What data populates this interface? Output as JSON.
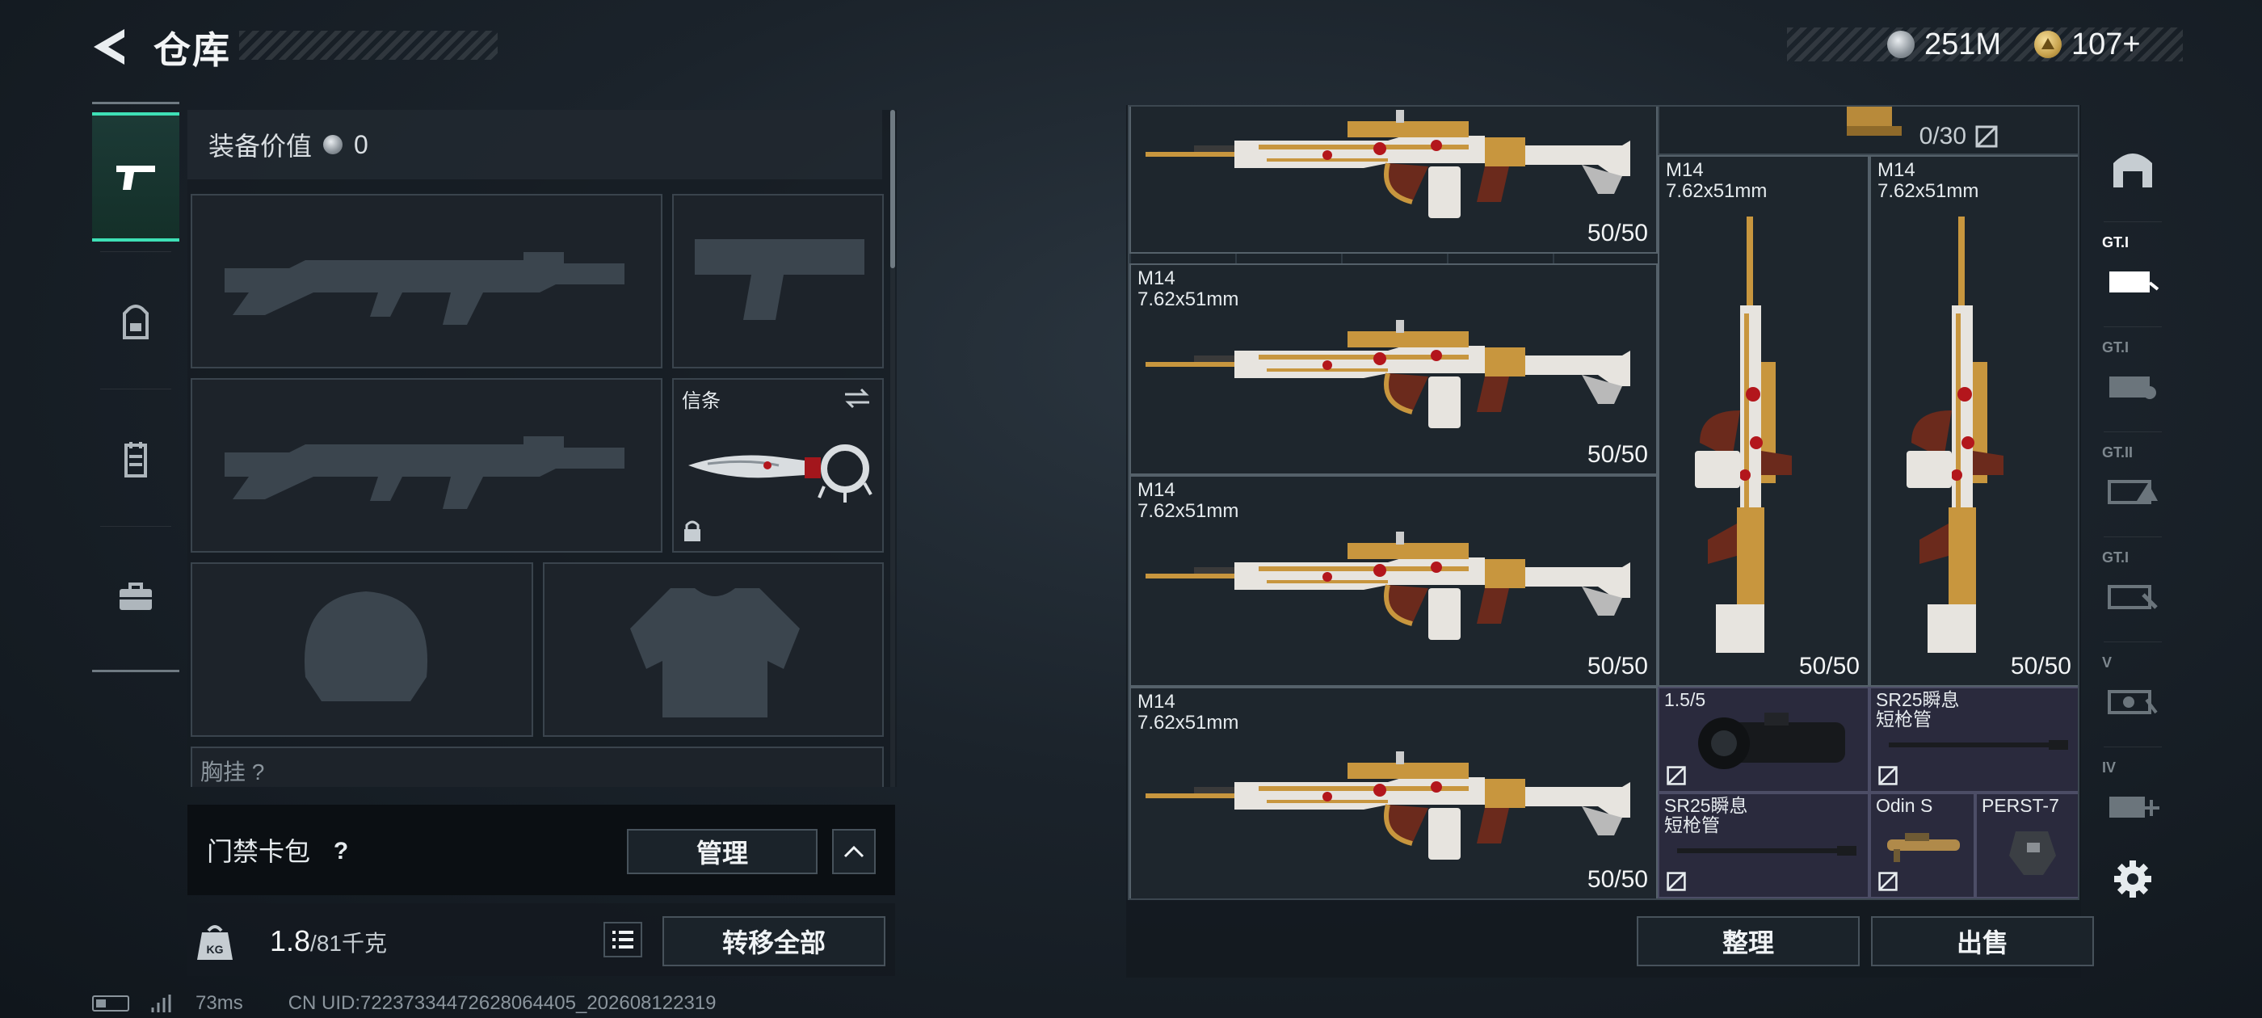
{
  "header": {
    "title": "仓库"
  },
  "currency": {
    "silver": "251M",
    "gold": "107+"
  },
  "loadout": {
    "equip_value_label": "装备价值",
    "equip_value": "0",
    "melee_label": "信条",
    "chest_label": "胸挂 ?",
    "keycard_label": "门禁卡包",
    "help_symbol": "?",
    "manage_label": "管理"
  },
  "footer": {
    "weight_current": "1.8",
    "weight_capacity": "/81千克",
    "transfer_label": "转移全部",
    "kg_icon_text": "KG"
  },
  "status": {
    "ping": "73ms",
    "uid": "CN UID:72237334472628064405_202608122319"
  },
  "storage": {
    "items": [
      {
        "name": "",
        "ammo": "50/50"
      },
      {
        "name": "M14\n7.62x51mm",
        "ammo": "50/50"
      },
      {
        "name": "M14\n7.62x51mm",
        "ammo": "50/50"
      },
      {
        "name": "M14\n7.62x51mm",
        "ammo": "50/50"
      },
      {
        "name": "M14\n7.62x51mm",
        "ammo": "50/50"
      },
      {
        "name": "M14\n7.62x51mm",
        "ammo": "50/50"
      }
    ],
    "mag_count": "0/30",
    "attachments": [
      {
        "name": "1.5/5"
      },
      {
        "name": "SR25瞬息\n短枪管"
      },
      {
        "name": "SR25瞬息\n短枪管"
      },
      {
        "name": "Odin S"
      },
      {
        "name": "PERST-7"
      }
    ],
    "sort_label": "整理",
    "sell_label": "出售"
  },
  "side_tabs": [
    "GT.I",
    "GT.I",
    "GT.II",
    "GT.I",
    "V",
    "IV"
  ],
  "colors": {
    "accent": "#3ee0b6",
    "gun_gold": "#c8963e",
    "gun_red": "#b3161c",
    "gun_white": "#e7e4df"
  }
}
